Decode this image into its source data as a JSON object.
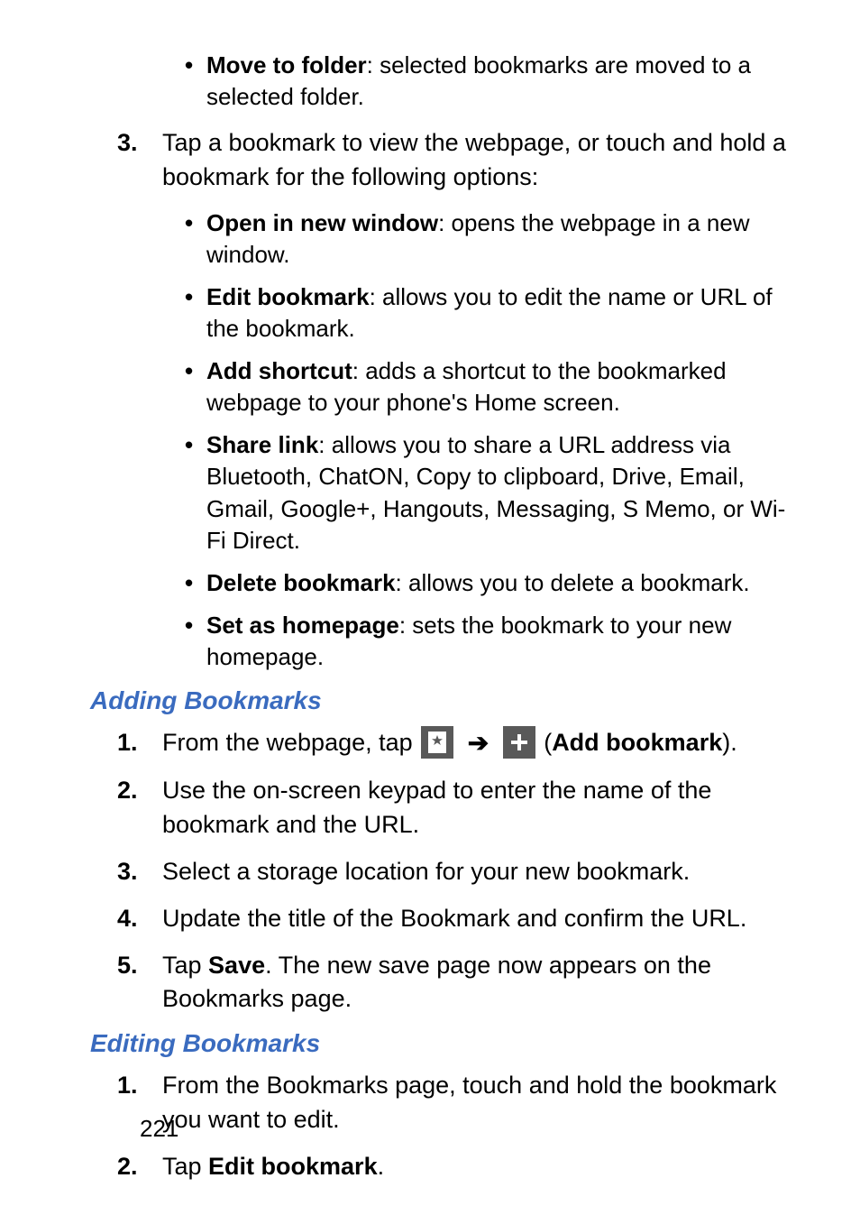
{
  "pageNumber": "221",
  "topBullets": [
    {
      "term": "Move to folder",
      "desc": ": selected bookmarks are moved to a selected folder."
    }
  ],
  "step3": {
    "marker": "3.",
    "text": "Tap a bookmark to view the webpage, or touch and hold a bookmark for the following options:"
  },
  "step3Bullets": [
    {
      "term": "Open in new window",
      "desc": ": opens the webpage in a new window."
    },
    {
      "term": "Edit bookmark",
      "desc": ": allows you to edit the name or URL of the bookmark."
    },
    {
      "term": "Add shortcut",
      "desc": ": adds a shortcut to the bookmarked webpage to your phone's Home screen."
    },
    {
      "term": "Share link",
      "desc": ": allows you to share a URL address via Bluetooth, ChatON, Copy to clipboard, Drive, Email, Gmail, Google+, Hangouts, Messaging, S Memo, or Wi-Fi Direct."
    },
    {
      "term": "Delete bookmark",
      "desc": ": allows you to delete a bookmark."
    },
    {
      "term": "Set as homepage",
      "desc": ": sets the bookmark to your new homepage."
    }
  ],
  "sectionAdding": {
    "title": "Adding Bookmarks",
    "steps": {
      "s1": {
        "marker": "1.",
        "pre": "From the webpage, tap ",
        "post_open": " (",
        "post_bold": "Add bookmark",
        "post_close": ")."
      },
      "s2": {
        "marker": "2.",
        "text": "Use the on-screen keypad to enter the name of the bookmark and the URL."
      },
      "s3": {
        "marker": "3.",
        "text": "Select a storage location for your new bookmark."
      },
      "s4": {
        "marker": "4.",
        "text": "Update the title of the Bookmark and confirm the URL."
      },
      "s5": {
        "marker": "5.",
        "pre": "Tap ",
        "bold": "Save",
        "post": ". The new save page now appears on the Bookmarks page."
      }
    }
  },
  "sectionEditing": {
    "title": "Editing Bookmarks",
    "steps": {
      "s1": {
        "marker": "1.",
        "text": "From the Bookmarks page, touch and hold the bookmark you want to edit."
      },
      "s2": {
        "marker": "2.",
        "pre": "Tap ",
        "bold": "Edit bookmark",
        "post": "."
      }
    }
  },
  "arrowGlyph": "➔"
}
